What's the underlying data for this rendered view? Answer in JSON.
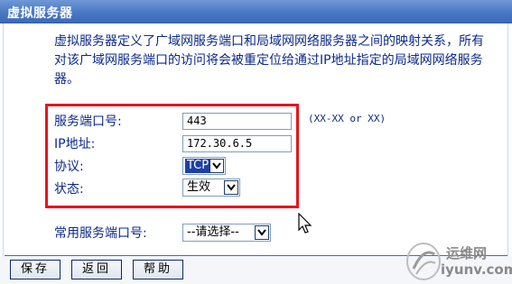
{
  "window": {
    "title": "虚拟服务器"
  },
  "description": "虚拟服务器定义了广域网服务端口和局域网网络服务器之间的映射关系，所有对该广域网服务端口的访问将会被重定位给通过IP地址指定的局域网网络服务器。",
  "form": {
    "service_port": {
      "label": "服务端口号:",
      "value": "443",
      "hint": "(XX-XX or XX)"
    },
    "ip_address": {
      "label": "IP地址:",
      "value": "172.30.6.5"
    },
    "protocol": {
      "label": "协议:",
      "value": "TCP"
    },
    "status": {
      "label": "状态:",
      "value": "生效"
    },
    "common_port": {
      "label": "常用服务端口号:",
      "value": "--请选择--"
    }
  },
  "buttons": {
    "save": "保存",
    "back": "返回",
    "help": "帮助"
  },
  "watermark": {
    "cn": "运维网",
    "en": "iyunv.com"
  },
  "colors": {
    "title_bar": "#4a78c4",
    "highlight": "#e8141c",
    "label_text": "#0b2a8a",
    "selected": "#1e3fa8"
  }
}
